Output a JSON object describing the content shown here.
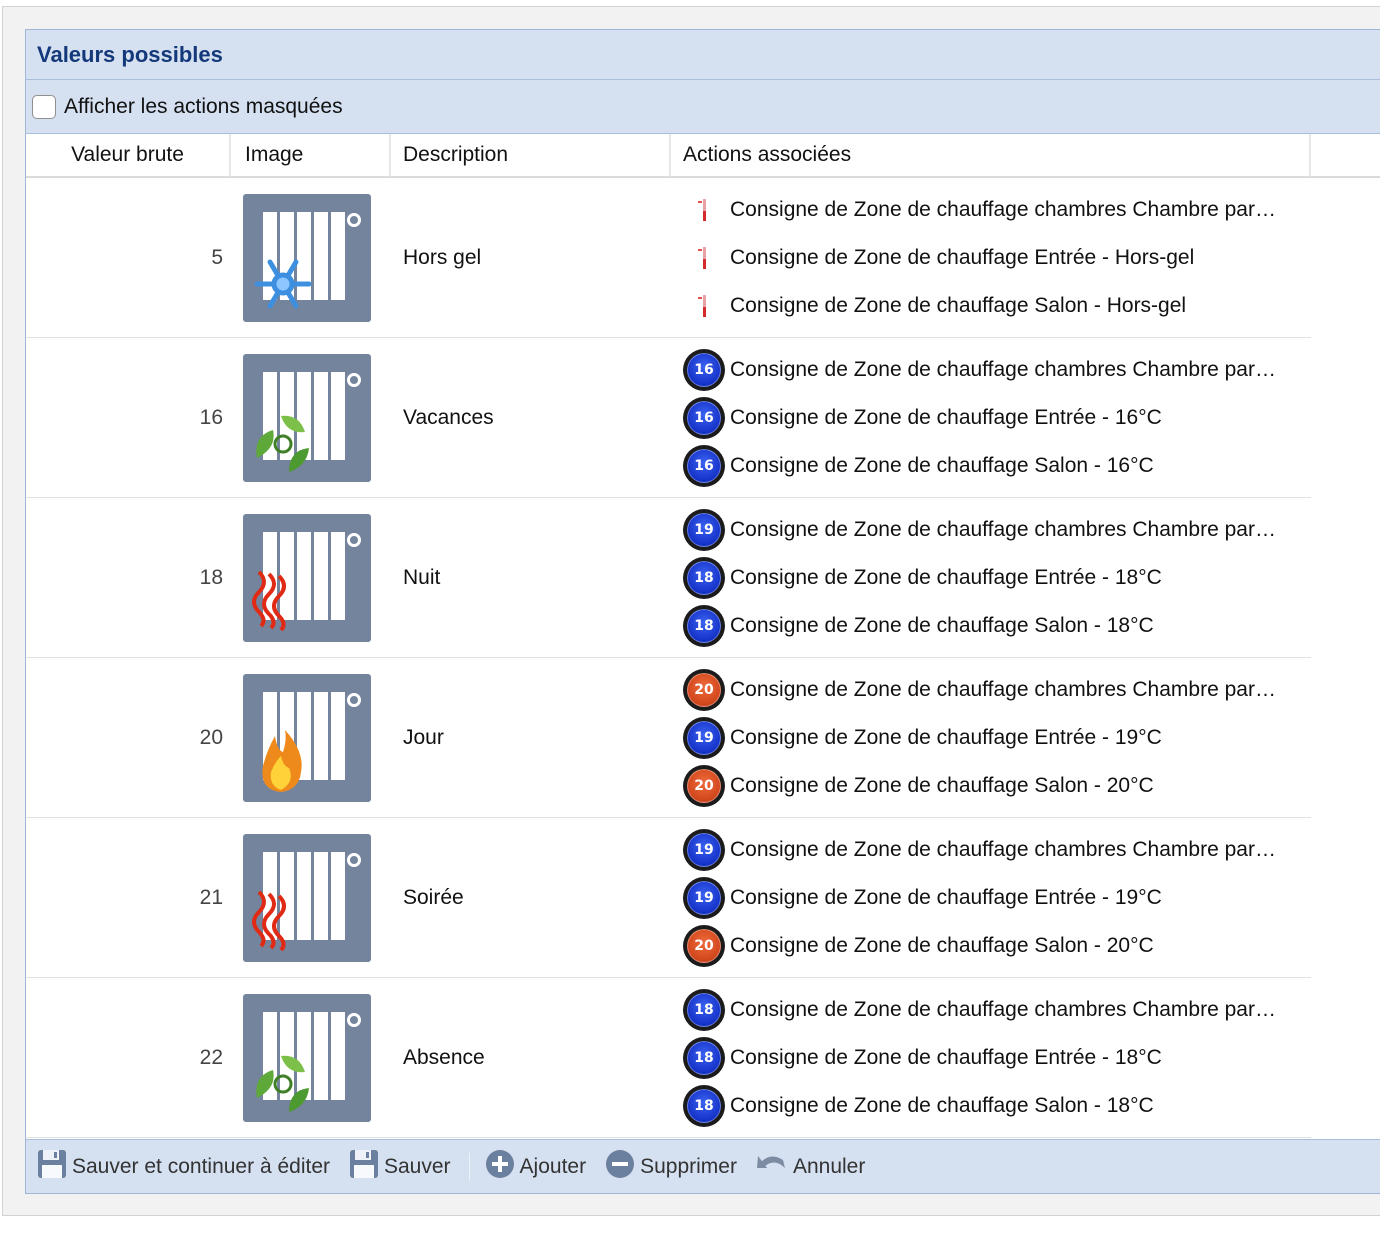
{
  "panel": {
    "title": "Valeurs possibles"
  },
  "options": {
    "show_hidden_label": "Afficher les actions masquées",
    "show_hidden_checked": false
  },
  "table": {
    "headers": {
      "value": "Valeur brute",
      "image": "Image",
      "description": "Description",
      "actions": "Actions associées"
    },
    "rows": [
      {
        "value": "5",
        "icon": "radiator-snowflake-icon",
        "description": "Hors gel",
        "actions": [
          {
            "badge": "thermometer",
            "text": "Consigne de Zone de chauffage chambres Chambre par…"
          },
          {
            "badge": "thermometer",
            "text": "Consigne de Zone de chauffage Entrée - Hors-gel"
          },
          {
            "badge": "thermometer",
            "text": "Consigne de Zone de chauffage Salon - Hors-gel"
          }
        ]
      },
      {
        "value": "16",
        "icon": "radiator-eco-leaves-icon",
        "description": "Vacances",
        "actions": [
          {
            "badge": "16",
            "badge_color": "blue",
            "text": "Consigne de Zone de chauffage chambres Chambre par…"
          },
          {
            "badge": "16",
            "badge_color": "blue",
            "text": "Consigne de Zone de chauffage Entrée - 16°C"
          },
          {
            "badge": "16",
            "badge_color": "blue",
            "text": "Consigne de Zone de chauffage Salon - 16°C"
          }
        ]
      },
      {
        "value": "18",
        "icon": "radiator-heat-waves-icon",
        "description": "Nuit",
        "actions": [
          {
            "badge": "19",
            "badge_color": "blue",
            "text": "Consigne de Zone de chauffage chambres Chambre par…"
          },
          {
            "badge": "18",
            "badge_color": "blue",
            "text": "Consigne de Zone de chauffage Entrée - 18°C"
          },
          {
            "badge": "18",
            "badge_color": "blue",
            "text": "Consigne de Zone de chauffage Salon - 18°C"
          }
        ]
      },
      {
        "value": "20",
        "icon": "radiator-flame-icon",
        "description": "Jour",
        "actions": [
          {
            "badge": "20",
            "badge_color": "red",
            "text": "Consigne de Zone de chauffage chambres Chambre par…"
          },
          {
            "badge": "19",
            "badge_color": "blue",
            "text": "Consigne de Zone de chauffage Entrée - 19°C"
          },
          {
            "badge": "20",
            "badge_color": "red",
            "text": "Consigne de Zone de chauffage Salon - 20°C"
          }
        ]
      },
      {
        "value": "21",
        "icon": "radiator-heat-waves-icon",
        "description": "Soirée",
        "actions": [
          {
            "badge": "19",
            "badge_color": "blue",
            "text": "Consigne de Zone de chauffage chambres Chambre par…"
          },
          {
            "badge": "19",
            "badge_color": "blue",
            "text": "Consigne de Zone de chauffage Entrée - 19°C"
          },
          {
            "badge": "20",
            "badge_color": "red",
            "text": "Consigne de Zone de chauffage Salon - 20°C"
          }
        ]
      },
      {
        "value": "22",
        "icon": "radiator-eco-leaves-icon",
        "description": "Absence",
        "actions": [
          {
            "badge": "18",
            "badge_color": "blue",
            "text": "Consigne de Zone de chauffage chambres Chambre par…"
          },
          {
            "badge": "18",
            "badge_color": "blue",
            "text": "Consigne de Zone de chauffage Entrée - 18°C"
          },
          {
            "badge": "18",
            "badge_color": "blue",
            "text": "Consigne de Zone de chauffage Salon - 18°C"
          }
        ]
      }
    ]
  },
  "toolbar": {
    "save_continue": "Sauver et continuer à éditer",
    "save": "Sauver",
    "add": "Ajouter",
    "delete": "Supprimer",
    "cancel": "Annuler"
  },
  "colors": {
    "header_bg": "#d5e0f1",
    "title": "#14397a",
    "tile_bg": "#74849d",
    "badge_blue": "#1533c9",
    "badge_red": "#d2471d"
  }
}
